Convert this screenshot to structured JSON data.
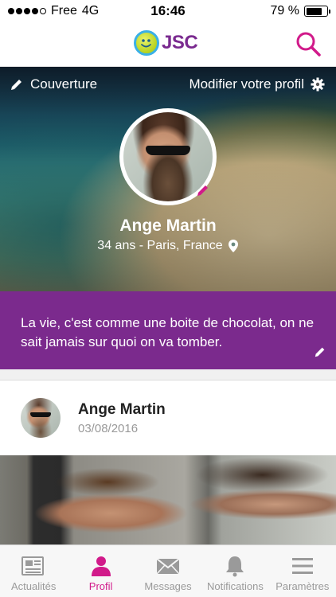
{
  "status_bar": {
    "carrier": "Free",
    "network": "4G",
    "time": "16:46",
    "battery_text": "79 %",
    "battery_level": 0.79
  },
  "header": {
    "logo_text": "JSC",
    "search_icon": "search-icon"
  },
  "cover": {
    "cover_label": "Couverture",
    "edit_profile_label": "Modifier votre profil",
    "name": "Ange Martin",
    "meta": "34 ans - Paris, France"
  },
  "bio": {
    "text": "La vie, c'est comme une boite de chocolat, on ne sait jamais sur quoi on va tomber."
  },
  "post": {
    "author": "Ange Martin",
    "date": "03/08/2016"
  },
  "tabs": [
    {
      "label": "Actualités",
      "icon": "newspaper-icon",
      "active": false
    },
    {
      "label": "Profil",
      "icon": "person-icon",
      "active": true
    },
    {
      "label": "Messages",
      "icon": "envelope-icon",
      "active": false
    },
    {
      "label": "Notifications",
      "icon": "bell-icon",
      "active": false
    },
    {
      "label": "Paramètres",
      "icon": "menu-icon",
      "active": false
    }
  ],
  "colors": {
    "accent": "#d11a8a",
    "bio_background": "#7b2a8d",
    "logo_text": "#7a2a8f",
    "inactive_tab": "#9a9a9a"
  }
}
